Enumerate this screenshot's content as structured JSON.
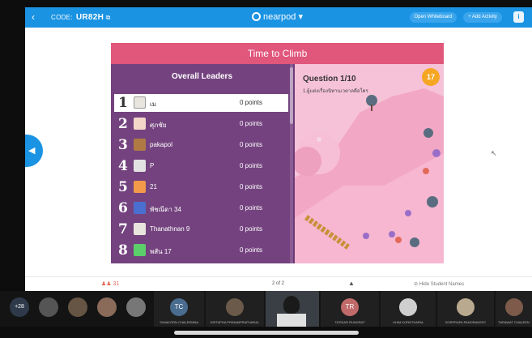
{
  "topbar": {
    "code_label": "CODE:",
    "code_value": "UR82H",
    "logo_text": "nearpod",
    "open_whiteboard": "Open Whiteboard",
    "add_activity": "+ Add Activity"
  },
  "game": {
    "title": "Time to Climb",
    "leaders_header": "Overall Leaders",
    "leaders": [
      {
        "rank": "1",
        "name": "เม",
        "points": "0 points",
        "avatar_color": "#e8e4de"
      },
      {
        "rank": "2",
        "name": "ศุภชัย",
        "points": "0 points",
        "avatar_color": "#f3d7c9"
      },
      {
        "rank": "3",
        "name": "pakapol",
        "points": "0 points",
        "avatar_color": "#b07a45"
      },
      {
        "rank": "4",
        "name": "P",
        "points": "0 points",
        "avatar_color": "#e2e2e2"
      },
      {
        "rank": "5",
        "name": "21",
        "points": "0 points",
        "avatar_color": "#f39a4a"
      },
      {
        "rank": "6",
        "name": "พัชณีดา 34",
        "points": "0 points",
        "avatar_color": "#4a6fd0"
      },
      {
        "rank": "7",
        "name": "Thanathnan 9",
        "points": "0 points",
        "avatar_color": "#e8e4de"
      },
      {
        "rank": "8",
        "name": "พสัน 17",
        "points": "0 points",
        "avatar_color": "#5bd06a"
      }
    ],
    "question_title": "Question 1/10",
    "question_text": "1.ผู้แต่งเรื่องนิทานเวตาลคือใคร",
    "timer": "17"
  },
  "bottombar": {
    "students": "31",
    "page": "2 of 2",
    "hide_names": "Hide Student Names"
  },
  "meet": {
    "more_count": "+28",
    "tiles": [
      {
        "name": "",
        "initials": "",
        "color": "#555"
      },
      {
        "name": "",
        "initials": "",
        "color": "#665544"
      },
      {
        "name": "",
        "initials": "",
        "color": "#8a6a58"
      },
      {
        "name": "",
        "initials": "",
        "color": "#777"
      },
      {
        "name": "TANAKORN CHALERMNA",
        "initials": "TC",
        "color": "#4a6c8f"
      },
      {
        "name": "KRITAPHA PRINAMPRAPHARAL",
        "initials": "",
        "color": "#6b5a4a"
      },
      {
        "name": "",
        "initials": "",
        "color": "#3a3f45"
      },
      {
        "name": "TATIDAR RUNGRAT",
        "initials": "TR",
        "color": "#c06a6a"
      },
      {
        "name": "KHIM KORNTHARIA",
        "initials": "",
        "color": "#cfcfcf"
      },
      {
        "name": "SORPRAPA PANORANSSY",
        "initials": "",
        "color": "#b9a98e"
      },
      {
        "name": "TARAWAT CHALEEN",
        "initials": "",
        "color": "#7d5a4a"
      }
    ]
  }
}
